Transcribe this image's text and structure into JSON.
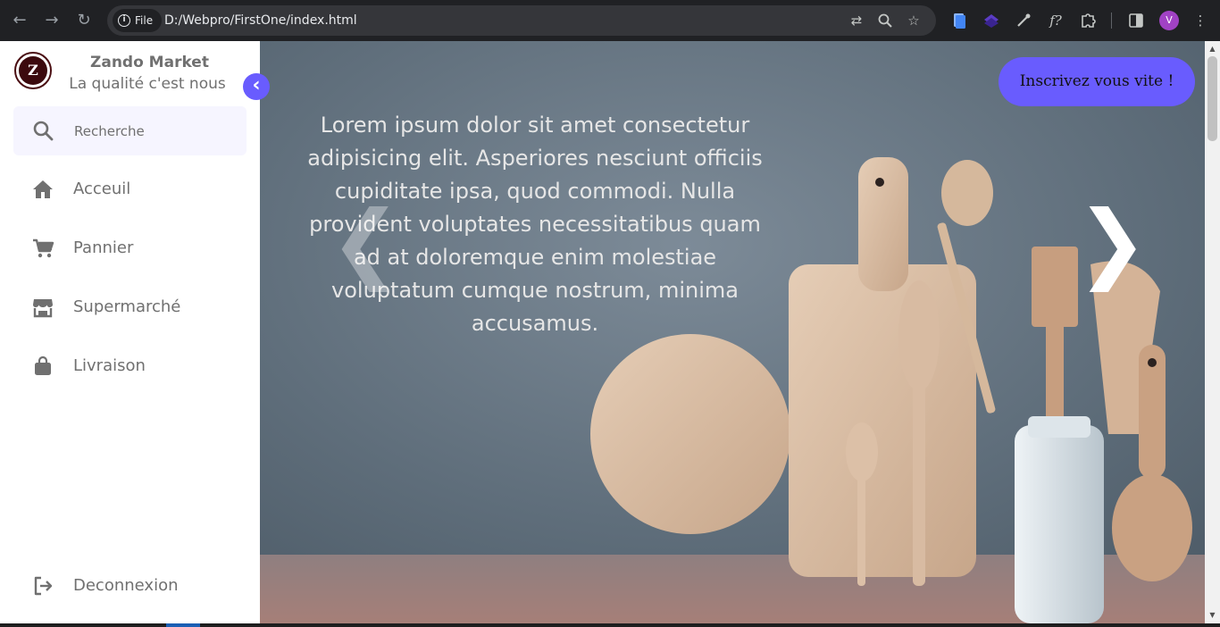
{
  "browser": {
    "chip_label": "File",
    "url": "D:/Webpro/FirstOne/index.html",
    "profile_initial": "V"
  },
  "sidebar": {
    "brand_name": "Zando Market",
    "brand_tagline": "La qualité c'est nous",
    "logo_letter": "Z",
    "search_placeholder": "Recherche",
    "items": [
      {
        "label": "Acceuil",
        "icon": "home-icon"
      },
      {
        "label": "Pannier",
        "icon": "cart-icon"
      },
      {
        "label": "Supermarché",
        "icon": "store-icon"
      },
      {
        "label": "Livraison",
        "icon": "shopping-bag-icon"
      }
    ],
    "logout_label": "Deconnexion"
  },
  "hero": {
    "text": "Lorem ipsum dolor sit amet consectetur adipisicing elit. Asperiores nesciunt officiis cupiditate ipsa, quod commodi. Nulla provident voluptates necessitatibus quam ad at doloremque enim molestiae voluptatum cumque nostrum, minima accusamus.",
    "prev_glyph": "❮",
    "next_glyph": "❯",
    "cta_label": "Inscrivez vous vite !"
  },
  "colors": {
    "accent": "#695cfe",
    "sidebar_text": "#707070",
    "search_bg": "#f6f5ff",
    "chrome_bg": "#202124"
  }
}
